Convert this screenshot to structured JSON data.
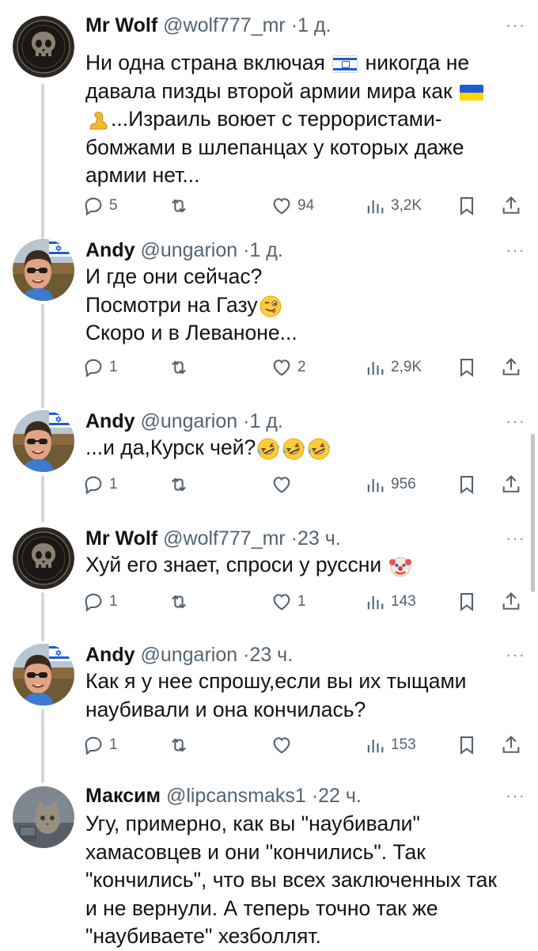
{
  "tweets": [
    {
      "name": "Mr Wolf",
      "handle": "@wolf777_mr",
      "dot": "·",
      "time": "1 д.",
      "more": "···",
      "lines": [
        [
          "Ни одна страна включая ",
          "{flag-il}",
          " никогда не"
        ],
        [
          "давала пизды второй армии мира как ",
          "{flag-ua}"
        ],
        [
          "{emoji-bicep}",
          "...Израиль воюет с террористами-"
        ],
        [
          "бомжами в шлепанцах у которых даже"
        ],
        [
          "армии нет..."
        ]
      ],
      "replies": "5",
      "retweets": "",
      "likes": "94",
      "views": "3,2K",
      "avatar": "punisher-skull-avatar"
    },
    {
      "name": "Andy",
      "handle": "@ungarion",
      "dot": "·",
      "time": "1 д.",
      "more": "···",
      "lines": [
        [
          "И где они сейчас?"
        ],
        [
          "Посмотри на Газу",
          "{emoji-wink-tongue}"
        ],
        [
          "Скоро и в Леваноне..."
        ]
      ],
      "replies": "1",
      "retweets": "",
      "likes": "2",
      "views": "2,9K",
      "avatar": "man-sunglasses-israel-flag-avatar"
    },
    {
      "name": "Andy",
      "handle": "@ungarion",
      "dot": "·",
      "time": "1 д.",
      "more": "···",
      "lines": [
        [
          "...и да,Курск чей?",
          "{emoji-rofl}",
          "{emoji-rofl}",
          "{emoji-rofl}"
        ]
      ],
      "replies": "1",
      "retweets": "",
      "likes": "",
      "views": "956",
      "avatar": "man-sunglasses-israel-flag-avatar"
    },
    {
      "name": "Mr Wolf",
      "handle": "@wolf777_mr",
      "dot": "·",
      "time": "23 ч.",
      "more": "···",
      "lines": [
        [
          "Хуй его знает, спроси у руссни ",
          "{emoji-clown}"
        ]
      ],
      "replies": "1",
      "retweets": "",
      "likes": "1",
      "views": "143",
      "avatar": "punisher-skull-avatar"
    },
    {
      "name": "Andy",
      "handle": "@ungarion",
      "dot": "·",
      "time": "23 ч.",
      "more": "···",
      "lines": [
        [
          "Как я у нее спрошу,если вы их тыщами"
        ],
        [
          "наубивали и она кончилась?"
        ]
      ],
      "replies": "1",
      "retweets": "",
      "likes": "",
      "views": "153",
      "avatar": "man-sunglasses-israel-flag-avatar"
    },
    {
      "name": "Максим",
      "handle": "@lipcansmaks1",
      "dot": "·",
      "time": "22 ч.",
      "more": "···",
      "lines": [
        [
          "Угу, примерно, как вы \"наубивали\""
        ],
        [
          "хамасовцев и они \"кончились\". Так"
        ],
        [
          "\"кончились\", что вы всех заключенных так"
        ],
        [
          "и не вернули. А теперь точно так же"
        ],
        [
          "\"наубиваете\" хезболлят."
        ]
      ],
      "replies": "",
      "retweets": "",
      "likes": "",
      "views": "",
      "avatar": "cat-photo-avatar"
    }
  ],
  "icons": {
    "reply": "reply-icon",
    "retweet": "retweet-icon",
    "like": "heart-icon",
    "views": "views-chart-icon",
    "bookmark": "bookmark-icon",
    "share": "share-icon"
  },
  "colors": {
    "text": "#0f1419",
    "secondary": "#536471",
    "thread_line": "#cfd9de"
  }
}
